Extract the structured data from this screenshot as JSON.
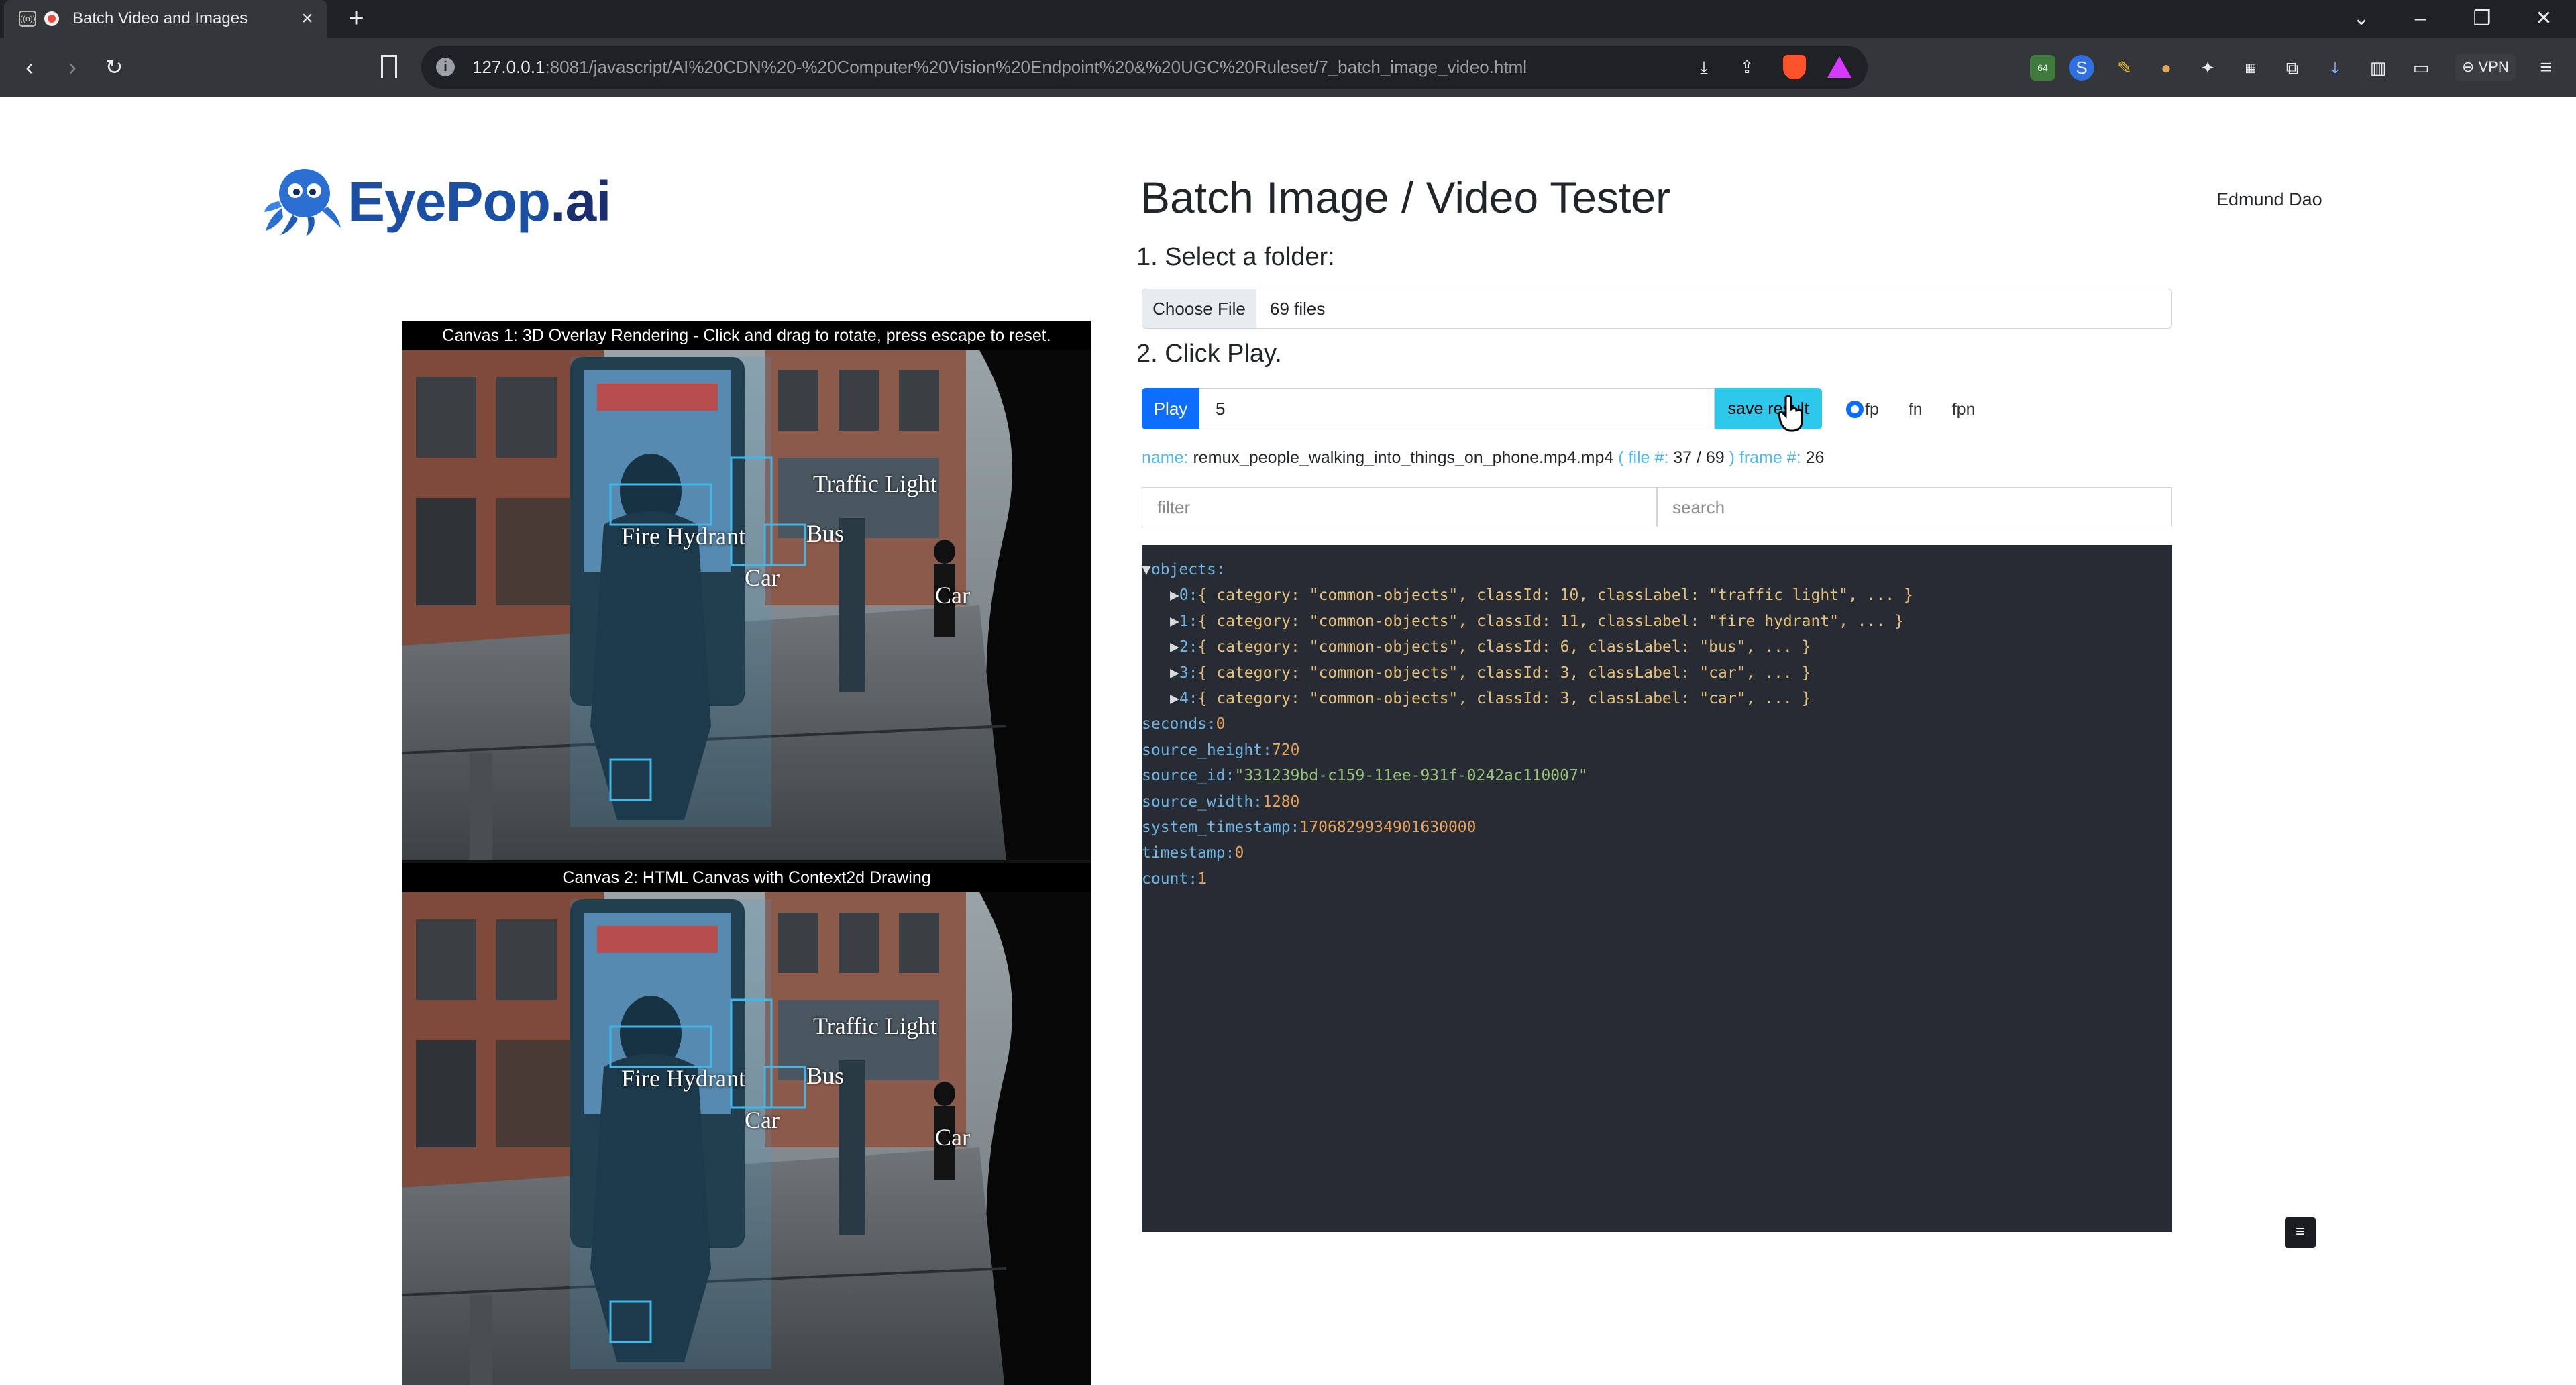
{
  "browser": {
    "tab_title": "Batch Video and Images",
    "tab_close": "×",
    "new_tab": "+",
    "url_host": "127.0.0.1",
    "url_path": ":8081/javascript/AI%20CDN%20-%20Computer%20Vision%20Endpoint%20&%20UGC%20Ruleset/7_batch_image_video.html",
    "extension_badge": "64",
    "vpn_label": "VPN"
  },
  "page": {
    "title": "Batch Image / Video Tester",
    "user_name": "Edmund Dao",
    "logo_main": "EyePop",
    "logo_suffix": ".ai",
    "step1": "1. Select a folder:",
    "step2": "2. Click Play.",
    "file_button": "Choose File",
    "file_status": "69 files",
    "play_label": "Play",
    "frame_value": "5",
    "save_label": "save result",
    "radio_options": [
      "fp",
      "fn",
      "fpn"
    ],
    "filter_placeholder": "filter",
    "search_placeholder": "search"
  },
  "status": {
    "name_label": "name:",
    "name_value": "remux_people_walking_into_things_on_phone.mp4.mp4",
    "file_label": "( file #:",
    "file_value": "37 / 69",
    "file_close": ")",
    "frame_label": "frame #:",
    "frame_value": "26"
  },
  "json_view": {
    "objects_key": "objects:",
    "objects": [
      {
        "index": "0:",
        "summary": "{ category: \"common-objects\", classId: 10, classLabel: \"traffic light\", ... }"
      },
      {
        "index": "1:",
        "summary": "{ category: \"common-objects\", classId: 11, classLabel: \"fire hydrant\", ... }"
      },
      {
        "index": "2:",
        "summary": "{ category: \"common-objects\", classId: 6, classLabel: \"bus\", ... }"
      },
      {
        "index": "3:",
        "summary": "{ category: \"common-objects\", classId: 3, classLabel: \"car\", ... }"
      },
      {
        "index": "4:",
        "summary": "{ category: \"common-objects\", classId: 3, classLabel: \"car\", ... }"
      }
    ],
    "fields": [
      {
        "key": "seconds:",
        "value": "0",
        "kind": "num"
      },
      {
        "key": "source_height:",
        "value": "720",
        "kind": "num"
      },
      {
        "key": "source_id:",
        "value": "\"331239bd-c159-11ee-931f-0242ac110007\"",
        "kind": "str"
      },
      {
        "key": "source_width:",
        "value": "1280",
        "kind": "num"
      },
      {
        "key": "system_timestamp:",
        "value": "1706829934901630000",
        "kind": "num"
      },
      {
        "key": "timestamp:",
        "value": "0",
        "kind": "num"
      },
      {
        "key": "count:",
        "value": "1",
        "kind": "num"
      }
    ],
    "toggle_icon": "≡"
  },
  "canvases": [
    {
      "caption": "Canvas 1: 3D Overlay Rendering - Click and drag to rotate, press escape to reset."
    },
    {
      "caption": "Canvas 2: HTML Canvas with Context2d Drawing"
    }
  ],
  "detections": [
    "Traffic Light",
    "Fire Hydrant",
    "Bus",
    "Car",
    "Car"
  ],
  "colors": {
    "accent": "#0d6efd",
    "save": "#2ec8ec",
    "json_bg": "#272c34",
    "detection_box": "#3fb8e8"
  }
}
